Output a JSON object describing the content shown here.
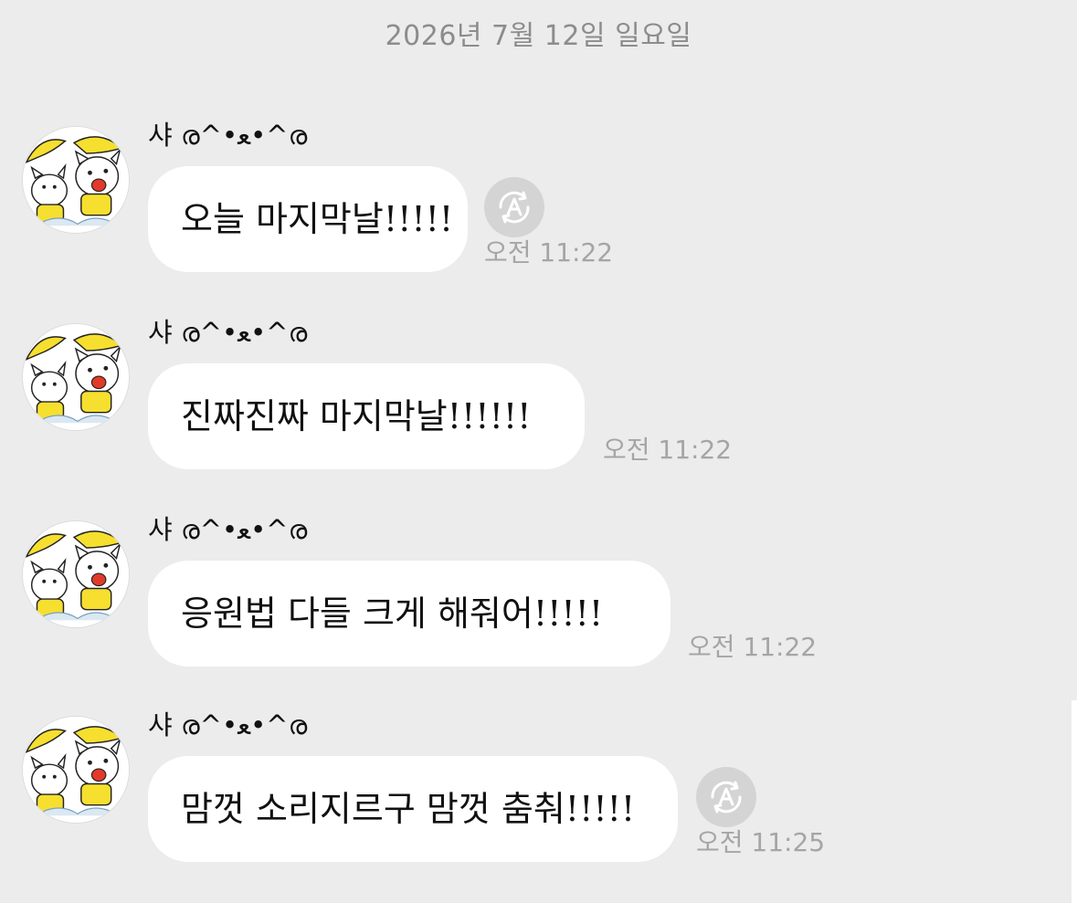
{
  "chat": {
    "date": "2026년 7월 12일 일요일",
    "messages": [
      {
        "sender": "샤 ര^•ﻌ•^ര",
        "text": "오늘 마지막날!!!!!",
        "time": "오전 11:22",
        "has_translate_icon": true
      },
      {
        "sender": "샤 ര^•ﻌ•^ര",
        "text": "진짜진짜 마지막날!!!!!!",
        "time": "오전 11:22",
        "has_translate_icon": false
      },
      {
        "sender": "샤 ര^•ﻌ•^ര",
        "text": "응원법 다들 크게 해줘어!!!!!",
        "time": "오전 11:22",
        "has_translate_icon": false
      },
      {
        "sender": "샤 ര^•ﻌ•^ര",
        "text": "맘껏 소리지르구 맘껏 춤춰!!!!!",
        "time": "오전 11:25",
        "has_translate_icon": true
      }
    ]
  },
  "icons": {
    "avatar": "cartoon-cats-yellow-umbrella",
    "translate": "translate-a-circle-icon"
  },
  "colors": {
    "background": "#ececec",
    "bubble": "#ffffff",
    "timestamp": "#a5a5a5",
    "date_text": "#8c8c8c",
    "translate_button": "#d4d4d4"
  }
}
